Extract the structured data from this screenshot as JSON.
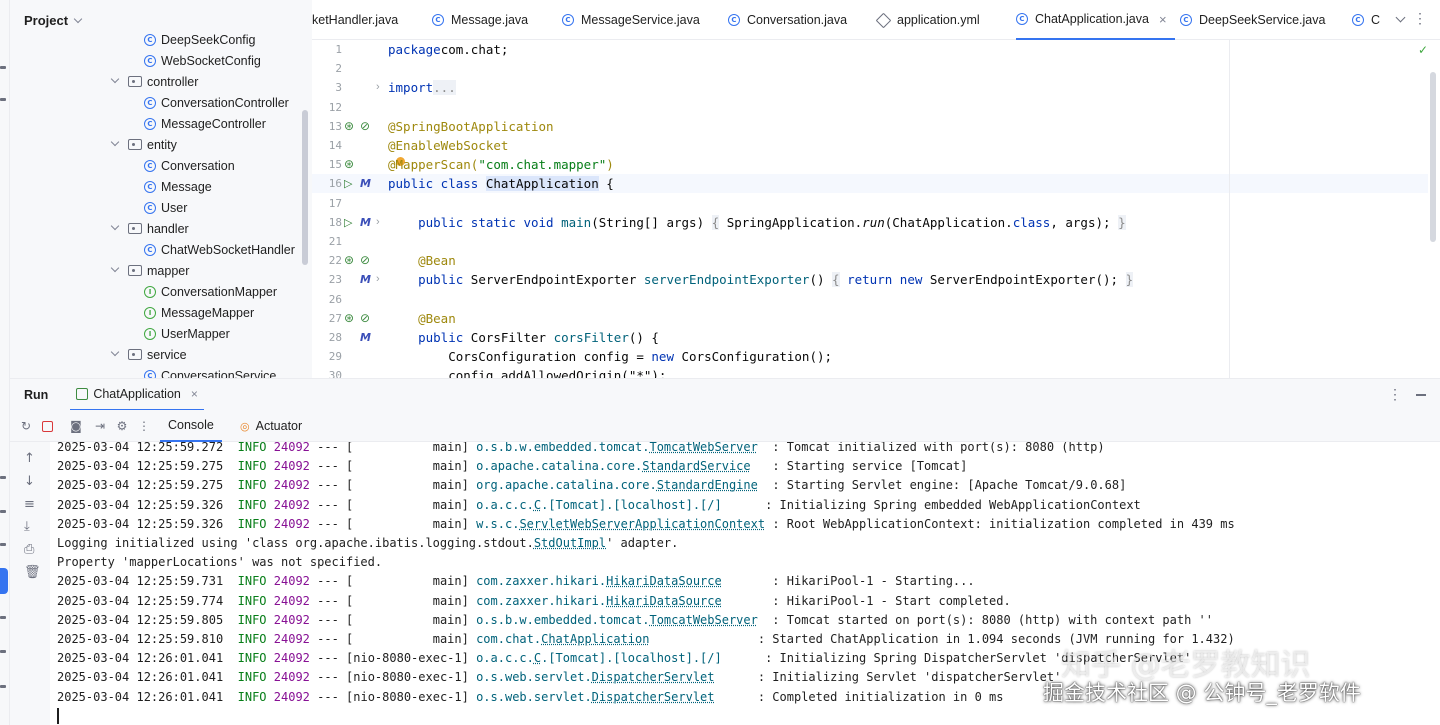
{
  "project": {
    "title": "Project",
    "tree": [
      {
        "label": "DeepSeekConfig",
        "kind": "class"
      },
      {
        "label": "WebSocketConfig",
        "kind": "class"
      },
      {
        "label": "controller",
        "kind": "package"
      },
      {
        "label": "ConversationController",
        "kind": "class"
      },
      {
        "label": "MessageController",
        "kind": "class"
      },
      {
        "label": "entity",
        "kind": "package"
      },
      {
        "label": "Conversation",
        "kind": "class"
      },
      {
        "label": "Message",
        "kind": "class"
      },
      {
        "label": "User",
        "kind": "class"
      },
      {
        "label": "handler",
        "kind": "package"
      },
      {
        "label": "ChatWebSocketHandler",
        "kind": "class"
      },
      {
        "label": "mapper",
        "kind": "package"
      },
      {
        "label": "ConversationMapper",
        "kind": "interface"
      },
      {
        "label": "MessageMapper",
        "kind": "interface"
      },
      {
        "label": "UserMapper",
        "kind": "interface"
      },
      {
        "label": "service",
        "kind": "package"
      },
      {
        "label": "ConversationService",
        "kind": "class"
      }
    ]
  },
  "tabs": [
    {
      "label": "ketHandler.java",
      "icon": "class-icon"
    },
    {
      "label": "Message.java",
      "icon": "class-icon"
    },
    {
      "label": "MessageService.java",
      "icon": "class-icon"
    },
    {
      "label": "Conversation.java",
      "icon": "class-icon"
    },
    {
      "label": "application.yml",
      "icon": "yaml-icon"
    },
    {
      "label": "ChatApplication.java",
      "icon": "class-icon",
      "active": true
    },
    {
      "label": "DeepSeekService.java",
      "icon": "class-icon"
    },
    {
      "label": "C",
      "icon": "class-icon"
    }
  ],
  "editor": {
    "line_numbers": [
      "1",
      "2",
      "3",
      "12",
      "13",
      "14",
      "15",
      "16",
      "17",
      "18",
      "21",
      "22",
      "23",
      "26",
      "27",
      "28",
      "29",
      "30"
    ],
    "lines": [
      {
        "t": [
          [
            "kw",
            "package"
          ],
          [
            "",
            "com.chat;"
          ]
        ]
      },
      {
        "t": []
      },
      {
        "t": [
          [
            "kw",
            "import"
          ],
          [
            "",
            ""
          ],
          [
            "fold",
            "..."
          ]
        ]
      },
      {
        "t": []
      },
      {
        "t": [
          [
            "ann",
            "@SpringBootApplication"
          ]
        ]
      },
      {
        "t": [
          [
            "ann",
            "@EnableWebSocket"
          ]
        ]
      },
      {
        "t": [
          [
            "ann",
            "@MapperScan("
          ],
          [
            "str",
            "\"com.chat.mapper\""
          ],
          [
            "ann",
            ")"
          ]
        ]
      },
      {
        "t": [
          [
            "kw",
            "public class "
          ],
          [
            "hl",
            "ChatApplication"
          ],
          [
            "",
            " {"
          ]
        ]
      },
      {
        "t": []
      },
      {
        "t": [
          [
            "",
            "    "
          ],
          [
            "kw",
            "public static void "
          ],
          [
            "fn",
            "main"
          ],
          [
            "",
            "(String[] args) "
          ],
          [
            "fold",
            "{"
          ],
          [
            "",
            " SpringApplication."
          ],
          [
            "it",
            "run"
          ],
          [
            "",
            "(ChatApplication."
          ],
          [
            "kw",
            "class"
          ],
          [
            "",
            ", args); "
          ],
          [
            "fold",
            "}"
          ]
        ]
      },
      {
        "t": []
      },
      {
        "t": [
          [
            "",
            "    "
          ],
          [
            "ann",
            "@Bean"
          ]
        ]
      },
      {
        "t": [
          [
            "",
            "    "
          ],
          [
            "kw",
            "public "
          ],
          [
            "",
            "ServerEndpointExporter "
          ],
          [
            "fn",
            "serverEndpointExporter"
          ],
          [
            "",
            "() "
          ],
          [
            "fold",
            "{"
          ],
          [
            "",
            " "
          ],
          [
            "kw",
            "return new "
          ],
          [
            "",
            "ServerEndpointExporter(); "
          ],
          [
            "fold",
            "}"
          ]
        ]
      },
      {
        "t": []
      },
      {
        "t": [
          [
            "",
            "    "
          ],
          [
            "ann",
            "@Bean"
          ]
        ]
      },
      {
        "t": [
          [
            "",
            "    "
          ],
          [
            "kw",
            "public "
          ],
          [
            "",
            "CorsFilter "
          ],
          [
            "fn",
            "corsFilter"
          ],
          [
            "",
            "() {"
          ]
        ]
      },
      {
        "t": [
          [
            "",
            "        CorsConfiguration config = "
          ],
          [
            "kw",
            "new "
          ],
          [
            "",
            "CorsConfiguration();"
          ]
        ]
      },
      {
        "t": [
          [
            "",
            "        config.addAllowedOrigin(\"*\");"
          ]
        ]
      }
    ]
  },
  "run": {
    "title": "Run",
    "config_tab": "ChatApplication",
    "console_tab": "Console",
    "actuator_tab": "Actuator"
  },
  "console": {
    "lines": [
      {
        "ts": "2025-03-04 12:25:59.272",
        "lvl": "INFO",
        "pid": "24092",
        "thr": "--- [           main]",
        "pkg": "o.s.b.w.embedded.tomcat.",
        "cls": "TomcatWebServer",
        "pad": "  ",
        "msg": ": Tomcat initialized with port(s): 8080 (http)"
      },
      {
        "ts": "2025-03-04 12:25:59.275",
        "lvl": "INFO",
        "pid": "24092",
        "thr": "--- [           main]",
        "pkg": "o.apache.catalina.core.",
        "cls": "StandardService",
        "pad": "   ",
        "msg": ": Starting service [Tomcat]"
      },
      {
        "ts": "2025-03-04 12:25:59.275",
        "lvl": "INFO",
        "pid": "24092",
        "thr": "--- [           main]",
        "pkg": "org.apache.catalina.core.",
        "cls": "StandardEngine",
        "pad": "  ",
        "msg": ": Starting Servlet engine: [Apache Tomcat/9.0.68]"
      },
      {
        "ts": "2025-03-04 12:25:59.326",
        "lvl": "INFO",
        "pid": "24092",
        "thr": "--- [           main]",
        "pkg": "o.a.c.c.",
        "cls": "C",
        "pkg2": ".[Tomcat].[localhost].[/]",
        "pad": "      ",
        "msg": ": Initializing Spring embedded WebApplicationContext"
      },
      {
        "ts": "2025-03-04 12:25:59.326",
        "lvl": "INFO",
        "pid": "24092",
        "thr": "--- [           main]",
        "pkg": "w.s.c.",
        "cls": "ServletWebServerApplicationContext",
        "pad": " ",
        "msg": ": Root WebApplicationContext: initialization completed in 439 ms"
      },
      {
        "plain": "Logging initialized using 'class org.apache.ibatis.logging.stdout.",
        "cls": "StdOutImpl",
        "tail": "' adapter."
      },
      {
        "plain": "Property 'mapperLocations' was not specified."
      },
      {
        "ts": "2025-03-04 12:25:59.731",
        "lvl": "INFO",
        "pid": "24092",
        "thr": "--- [           main]",
        "pkg": "com.zaxxer.hikari.",
        "cls": "HikariDataSource",
        "pad": "       ",
        "msg": ": HikariPool-1 - Starting..."
      },
      {
        "ts": "2025-03-04 12:25:59.774",
        "lvl": "INFO",
        "pid": "24092",
        "thr": "--- [           main]",
        "pkg": "com.zaxxer.hikari.",
        "cls": "HikariDataSource",
        "pad": "       ",
        "msg": ": HikariPool-1 - Start completed."
      },
      {
        "ts": "2025-03-04 12:25:59.805",
        "lvl": "INFO",
        "pid": "24092",
        "thr": "--- [           main]",
        "pkg": "o.s.b.w.embedded.tomcat.",
        "cls": "TomcatWebServer",
        "pad": "  ",
        "msg": ": Tomcat started on port(s): 8080 (http) with context path ''"
      },
      {
        "ts": "2025-03-04 12:25:59.810",
        "lvl": "INFO",
        "pid": "24092",
        "thr": "--- [           main]",
        "pkg": "com.chat.",
        "cls": "ChatApplication",
        "pad": "               ",
        "msg": ": Started ChatApplication in 1.094 seconds (JVM running for 1.432)"
      },
      {
        "ts": "2025-03-04 12:26:01.041",
        "lvl": "INFO",
        "pid": "24092",
        "thr": "--- [nio-8080-exec-1]",
        "pkg": "o.a.c.c.",
        "cls": "C",
        "pkg2": ".[Tomcat].[localhost].[/]",
        "pad": "      ",
        "msg": ": Initializing Spring DispatcherServlet 'dispatcherServlet'"
      },
      {
        "ts": "2025-03-04 12:26:01.041",
        "lvl": "INFO",
        "pid": "24092",
        "thr": "--- [nio-8080-exec-1]",
        "pkg": "o.s.web.servlet.",
        "cls": "DispatcherServlet",
        "pad": "      ",
        "msg": ": Initializing Servlet 'dispatcherServlet'"
      },
      {
        "ts": "2025-03-04 12:26:01.041",
        "lvl": "INFO",
        "pid": "24092",
        "thr": "--- [nio-8080-exec-1]",
        "pkg": "o.s.web.servlet.",
        "cls": "DispatcherServlet",
        "pad": "      ",
        "msg": ": Completed initialization in 0 ms"
      }
    ]
  },
  "watermark": {
    "line1": "知乎 @老罗教知识",
    "line2": "掘金技术社区 @ 公钟号_老罗软件"
  },
  "colors": {
    "accent": "#3574f0",
    "keyword": "#0033b3",
    "annotation": "#9e880d",
    "string": "#067d17",
    "log_level": "#067d17",
    "pid": "#871094",
    "class_link": "#00627a"
  }
}
